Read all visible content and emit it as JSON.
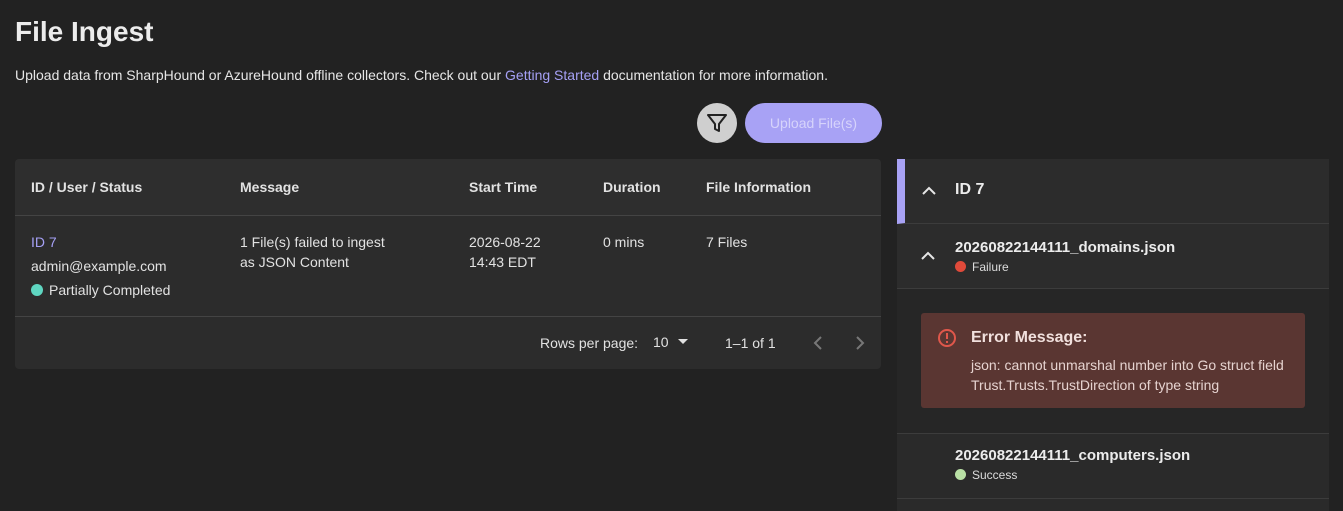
{
  "header": {
    "title": "File Ingest",
    "subtitle_prefix": "Upload data from SharpHound or AzureHound offline collectors. Check out our ",
    "subtitle_link": "Getting Started",
    "subtitle_suffix": " documentation for more information."
  },
  "toolbar": {
    "filter_icon": "filter-icon",
    "upload_label": "Upload File(s)"
  },
  "table": {
    "columns": [
      "ID / User / Status",
      "Message",
      "Start Time",
      "Duration",
      "File Information"
    ],
    "rows": [
      {
        "id": "ID 7",
        "user": "admin@example.com",
        "status": "Partially Completed",
        "status_color": "#5fd6c1",
        "message_line1": "1 File(s) failed to ingest",
        "message_line2": "as JSON Content",
        "start_date": "2026-08-22",
        "start_time": "14:43 EDT",
        "duration": "0 mins",
        "file_info": "7 Files"
      }
    ],
    "pagination": {
      "rows_per_page_label": "Rows per page:",
      "rows_per_page": "10",
      "range": "1–1 of 1"
    }
  },
  "side_panel": {
    "job_title": "ID 7",
    "files": [
      {
        "name": "20260822144111_domains.json",
        "status": "Failure",
        "status_color": "#e04a3a"
      },
      {
        "name": "20260822144111_computers.json",
        "status": "Success",
        "status_color": "#b9e0a5"
      }
    ],
    "error": {
      "title": "Error Message:",
      "text": "json: cannot unmarshal number into Go struct field Trust.Trusts.TrustDirection of type string"
    }
  },
  "colors": {
    "accent": "#a8a2f5",
    "background": "#222222",
    "error_bg": "#5a3632"
  }
}
